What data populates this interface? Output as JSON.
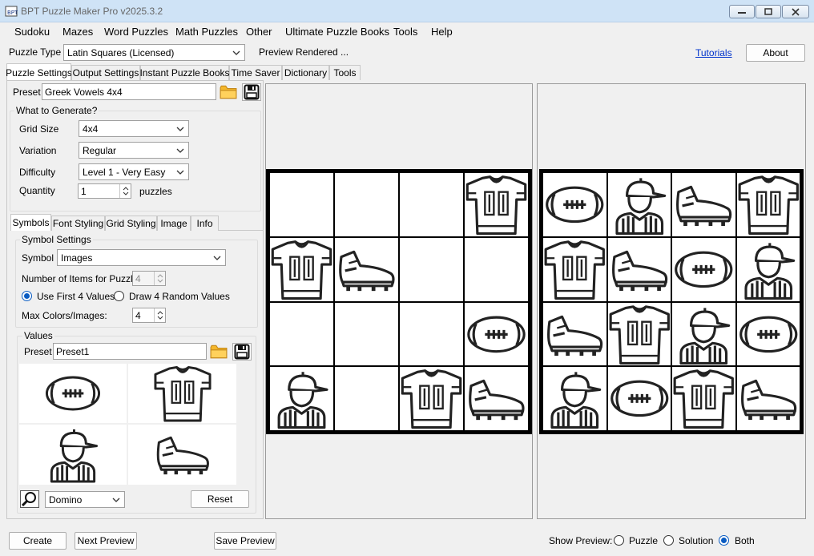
{
  "window": {
    "title": "BPT Puzzle Maker Pro v2025.3.2"
  },
  "menu": [
    "Sudoku",
    "Mazes",
    "Word Puzzles",
    "Math Puzzles",
    "Other",
    "Ultimate Puzzle Books",
    "Tools",
    "Help"
  ],
  "toolbar": {
    "puzzle_type_label": "Puzzle Type",
    "puzzle_type_value": "Latin Squares (Licensed)",
    "preview_status": "Preview Rendered ...",
    "tutorials_link": "Tutorials",
    "about_button": "About"
  },
  "tabs": [
    "Puzzle Settings",
    "Output Settings",
    "Instant Puzzle Books",
    "Time Saver",
    "Dictionary",
    "Tools"
  ],
  "preset": {
    "label": "Preset",
    "value": "Greek Vowels 4x4"
  },
  "generate": {
    "title": "What to Generate?",
    "grid_size_label": "Grid Size",
    "grid_size_value": "4x4",
    "variation_label": "Variation",
    "variation_value": "Regular",
    "difficulty_label": "Difficulty",
    "difficulty_value": "Level 1 - Very Easy",
    "quantity_label": "Quantity",
    "quantity_value": "1",
    "quantity_unit": "puzzles"
  },
  "subtabs": [
    "Symbols",
    "Font Styling",
    "Grid Styling",
    "Image",
    "Info"
  ],
  "symbol_settings": {
    "title": "Symbol Settings",
    "symbol_label": "Symbol",
    "symbol_value": "Images",
    "items_label": "Number of Items for Puzzle:",
    "items_value": "4",
    "radio_first": "Use First 4 Values",
    "radio_random": "Draw 4 Random Values",
    "max_colors_label": "Max Colors/Images:",
    "max_colors_value": "4"
  },
  "values": {
    "title": "Values",
    "preset_label": "Preset",
    "preset_value": "Preset1",
    "style_value": "Domino",
    "reset_button": "Reset",
    "images": [
      "football",
      "jersey",
      "referee",
      "cleat"
    ]
  },
  "puzzle_grid": [
    [
      "",
      "",
      "",
      "jersey"
    ],
    [
      "jersey",
      "cleat",
      "",
      ""
    ],
    [
      "",
      "",
      "",
      "football"
    ],
    [
      "referee",
      "",
      "jersey",
      "cleat"
    ]
  ],
  "solution_grid": [
    [
      "football",
      "referee",
      "cleat",
      "jersey"
    ],
    [
      "jersey",
      "cleat",
      "football",
      "referee"
    ],
    [
      "cleat",
      "jersey",
      "referee",
      "football"
    ],
    [
      "referee",
      "football",
      "jersey",
      "cleat"
    ]
  ],
  "bottom": {
    "create": "Create",
    "next_preview": "Next Preview",
    "save_preview": "Save Preview",
    "show_preview_label": "Show Preview:",
    "opt_puzzle": "Puzzle",
    "opt_solution": "Solution",
    "opt_both": "Both",
    "selected": "Both"
  }
}
